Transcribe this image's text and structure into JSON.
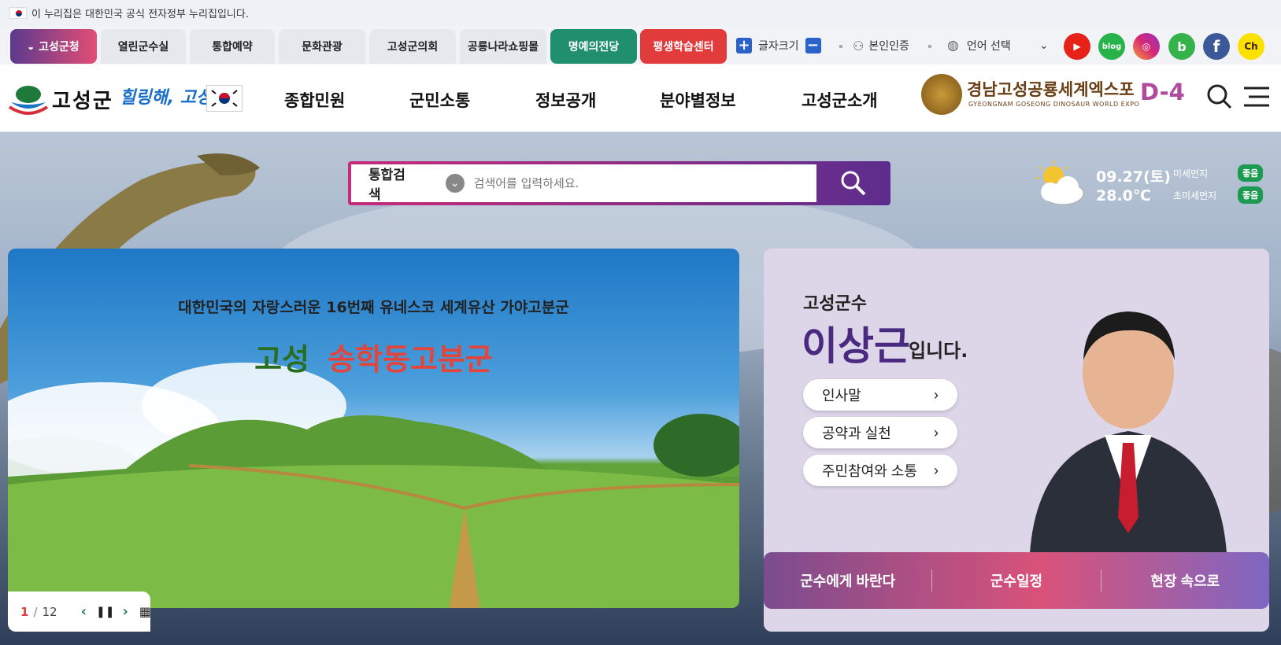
{
  "gov_notice": "이 누리집은 대한민국 공식 전자정부 누리집입니다.",
  "portal_tabs": [
    {
      "label": "고성군청"
    },
    {
      "label": "열린군수실"
    },
    {
      "label": "통합예약"
    },
    {
      "label": "문화관광"
    },
    {
      "label": "고성군의회"
    },
    {
      "label": "공룡나라쇼핑몰"
    },
    {
      "label": "명예의전당"
    },
    {
      "label": "평생학습센터"
    }
  ],
  "util": {
    "font_size_label": "글자크기",
    "plus": "+",
    "minus": "−",
    "auth_label": "본인인증",
    "language_label": "언어 선택"
  },
  "sns": [
    {
      "name": "youtube",
      "label": "▶",
      "color": "#e62117"
    },
    {
      "name": "blog",
      "label": "blog",
      "color": "#27b34a"
    },
    {
      "name": "instagram",
      "label": "◎",
      "color": "#c13584"
    },
    {
      "name": "band",
      "label": "b",
      "color": "#35b24a"
    },
    {
      "name": "facebook",
      "label": "f",
      "color": "#3b5998"
    },
    {
      "name": "kakao",
      "label": "Ch",
      "color": "#fae100"
    }
  ],
  "header": {
    "logo_text": "고성군",
    "slogan": "힐링해, 고성",
    "gnb": [
      "종합민원",
      "군민소통",
      "정보공개",
      "분야별정보",
      "고성군소개"
    ],
    "expo_title": "경남고성공룡세계엑스포",
    "expo_sub": "GYEONGNAM GOSEONG DINOSAUR WORLD EXPO",
    "dday": "D-4"
  },
  "search": {
    "category": "통합검색",
    "placeholder": "검색어를 입력하세요."
  },
  "weather": {
    "date": "09.27(토)",
    "temp": "28.0℃",
    "fine_dust_label": "미세먼지",
    "fine_dust_value": "좋음",
    "ultra_dust_label": "초미세먼지",
    "ultra_dust_value": "좋음"
  },
  "slide": {
    "headline": "대한민국의 자랑스러운 16번째 유네스코 세계유산 가야고분군",
    "title_a": "고성",
    "title_b": "송학동고분군",
    "current": "1",
    "separator": "/",
    "total": "12"
  },
  "mayor": {
    "role": "고성군수",
    "name": "이상근",
    "suffix": "입니다.",
    "links": [
      "인사말",
      "공약과 실천",
      "주민참여와 소통"
    ],
    "bar": [
      "군수에게 바란다",
      "군수일정",
      "현장 속으로"
    ]
  }
}
